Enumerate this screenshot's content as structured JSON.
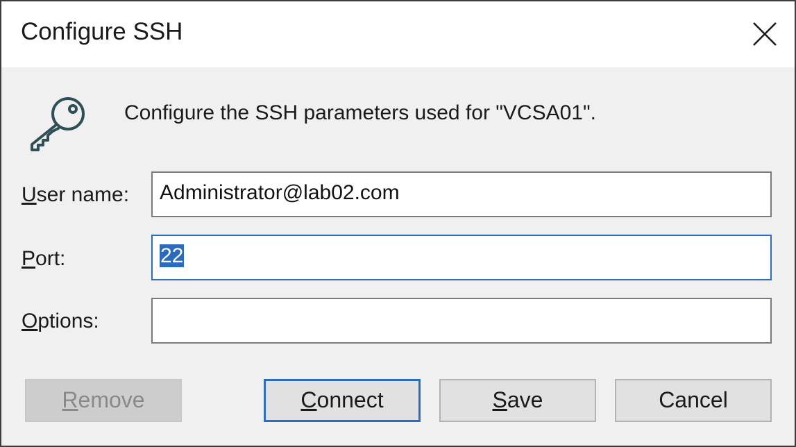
{
  "window": {
    "title": "Configure SSH"
  },
  "intro_text": "Configure the SSH parameters used for \"VCSA01\".",
  "fields": {
    "username": {
      "label_key": "U",
      "label_rest": "ser name:",
      "value": "Administrator@lab02.com"
    },
    "port": {
      "label_key": "P",
      "label_rest": "ort:",
      "value": "22"
    },
    "options": {
      "label_key": "O",
      "label_rest": "ptions:",
      "value": ""
    }
  },
  "buttons": {
    "remove": {
      "key": "R",
      "rest": "emove"
    },
    "connect": {
      "key": "C",
      "rest": "onnect"
    },
    "save": {
      "key": "S",
      "rest": "ave"
    },
    "cancel": {
      "label": "Cancel"
    }
  },
  "colors": {
    "accent": "#2b6cc4",
    "icon": "#2f4f56"
  },
  "icons": {
    "close": "close-icon",
    "key": "key-icon"
  }
}
